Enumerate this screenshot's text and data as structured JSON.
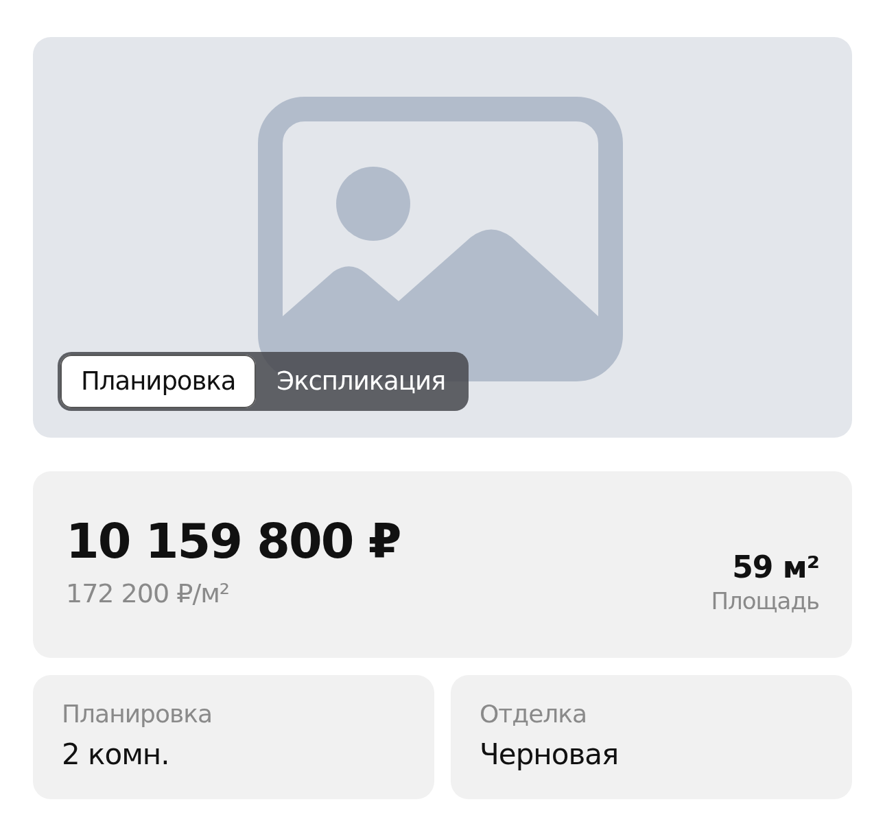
{
  "gallery": {
    "tabs": [
      {
        "label": "Планировка",
        "selected": true
      },
      {
        "label": "Экспликация",
        "selected": false
      }
    ]
  },
  "price": {
    "total": "10 159 800 ₽",
    "per_meter": "172 200 ₽/м²",
    "area": "59 м²",
    "area_label": "Площадь"
  },
  "details": [
    {
      "label": "Планировка",
      "value": "2 комн."
    },
    {
      "label": "Отделка",
      "value": "Черновая"
    }
  ]
}
